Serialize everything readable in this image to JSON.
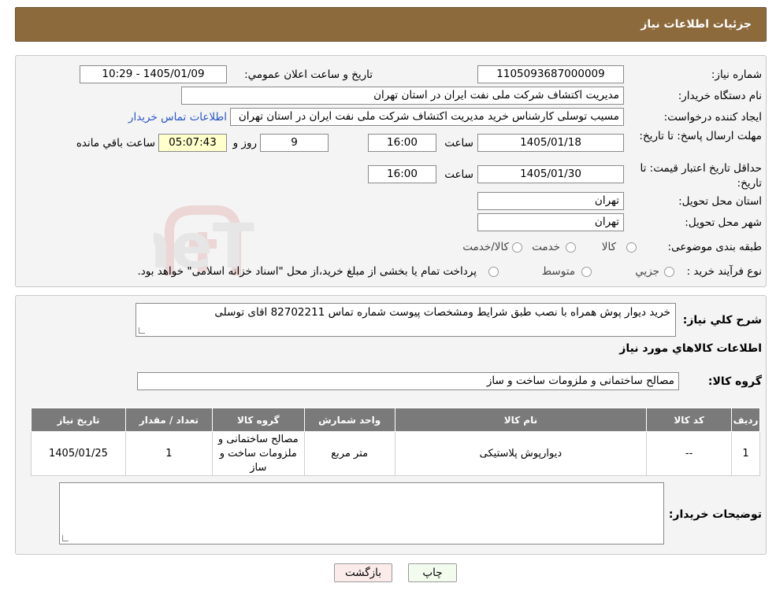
{
  "header": {
    "title": "جزئیات اطلاعات نیاز"
  },
  "form": {
    "need_number_label": "شماره نیاز:",
    "need_number": "1105093687000009",
    "announce_label": "تاریخ و ساعت اعلان عمومي:",
    "announce_value": "1405/01/09 - 10:29",
    "buyer_label": "نام دستگاه خريدار:",
    "buyer_value": "مدیریت اکتشاف شرکت ملی نفت ایران در استان تهران",
    "creator_label": "ايجاد كننده درخواست:",
    "creator_value": "مسیب توسلی کارشناس خرید مدیریت اکتشاف شرکت ملی نفت ایران در استان تهران",
    "contact_link": "اطلاعات تماس خريدار",
    "reply_deadline_label": "مهلت ارسال پاسخ: تا تاريخ:",
    "reply_date": "1405/01/18",
    "time_label": "ساعت",
    "reply_time": "16:00",
    "days": "9",
    "days_label": "روز و",
    "remaining_time": "05:07:43",
    "remaining_label": "ساعت باقي مانده",
    "price_validity_label": "حداقل تاريخ اعتبار قيمت: تا تاريخ:",
    "price_date": "1405/01/30",
    "price_time": "16:00",
    "province_label": "استان محل تحويل:",
    "province": "تهران",
    "city_label": "شهر محل تحويل:",
    "city": "تهران",
    "category_label": "طبقه بندی موضوعی:",
    "category_options": [
      "كالا",
      "خدمت",
      "كالا/خدمت"
    ],
    "process_label": "نوع فرآيند خريد :",
    "process_options": [
      "جزيي",
      "متوسط"
    ],
    "process_note": "پرداخت تمام يا بخشی از مبلغ خريد،از محل \"اسناد خزانه اسلامی\" خواهد بود."
  },
  "description": {
    "label": "شرح كلي نياز:",
    "text": "خرید دیوار پوش   همراه با نصب  طبق شرایط  ومشخصات پیوست  شماره تماس  82702211  اقای توسلی"
  },
  "goods": {
    "section_title": "اطلاعات کالاهاي مورد نياز",
    "group_label": "گروه کالا:",
    "group_value": "مصالح ساختمانی و ملزومات ساخت و ساز",
    "columns": [
      "رديف",
      "کد کالا",
      "نام کالا",
      "واحد شمارش",
      "گروه کالا",
      "تعداد / مقدار",
      "تاريخ نياز"
    ],
    "rows": [
      [
        "1",
        "--",
        "دیوارپوش پلاستیکی",
        "متر مربع",
        "مصالح ساختمانی و ملزومات ساخت و ساز",
        "1",
        "1405/01/25"
      ]
    ]
  },
  "buyer_notes": {
    "label": "توضيحات خريدار:",
    "text": ""
  },
  "buttons": {
    "print": "چاپ",
    "back": "بازگشت"
  },
  "watermark": {
    "text": "AriaTender.neT"
  },
  "colors": {
    "header": "#8c6a3c",
    "table_header": "#7a7a7a",
    "remaining_bg": "#ffffcc",
    "link": "#2a56c6"
  }
}
